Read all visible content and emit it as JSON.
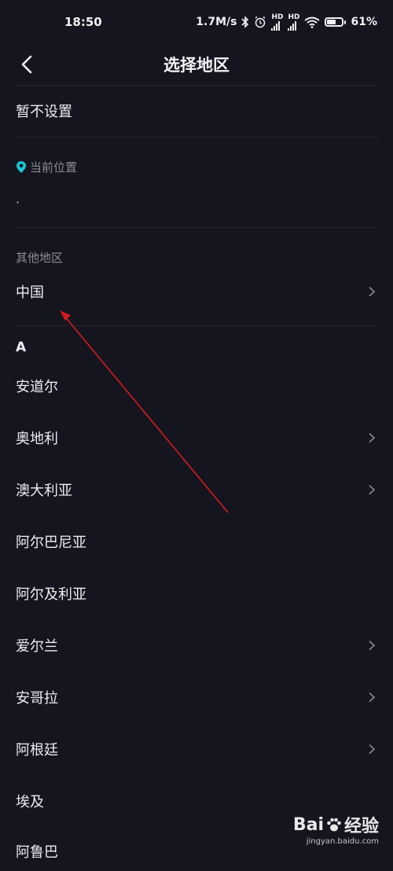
{
  "status": {
    "time": "18:50",
    "speed": "1.7M/s",
    "hd1": "HD",
    "hd2": "HD",
    "battery": "61",
    "battery_level": 0.61
  },
  "nav": {
    "title": "选择地区"
  },
  "options": {
    "not_set": "暂不设置",
    "current_location_label": "当前位置",
    "current_location_value": "·",
    "other_regions_label": "其他地区",
    "china": "中国"
  },
  "section_a": {
    "letter": "A",
    "items": [
      {
        "label": "安道尔"
      },
      {
        "label": "奥地利"
      },
      {
        "label": "澳大利亚"
      },
      {
        "label": "阿尔巴尼亚"
      },
      {
        "label": "阿尔及利亚"
      },
      {
        "label": "爱尔兰"
      },
      {
        "label": "安哥拉"
      },
      {
        "label": "阿根廷"
      },
      {
        "label": "埃及"
      },
      {
        "label": "阿鲁巴"
      }
    ]
  },
  "watermark": {
    "brand": "Bai",
    "brand_tail": "经验",
    "url": "jingyan.baidu.com"
  },
  "colors": {
    "background": "#15151f",
    "location_pin": "#19c7d6",
    "annotation_arrow": "#d21c1c"
  }
}
